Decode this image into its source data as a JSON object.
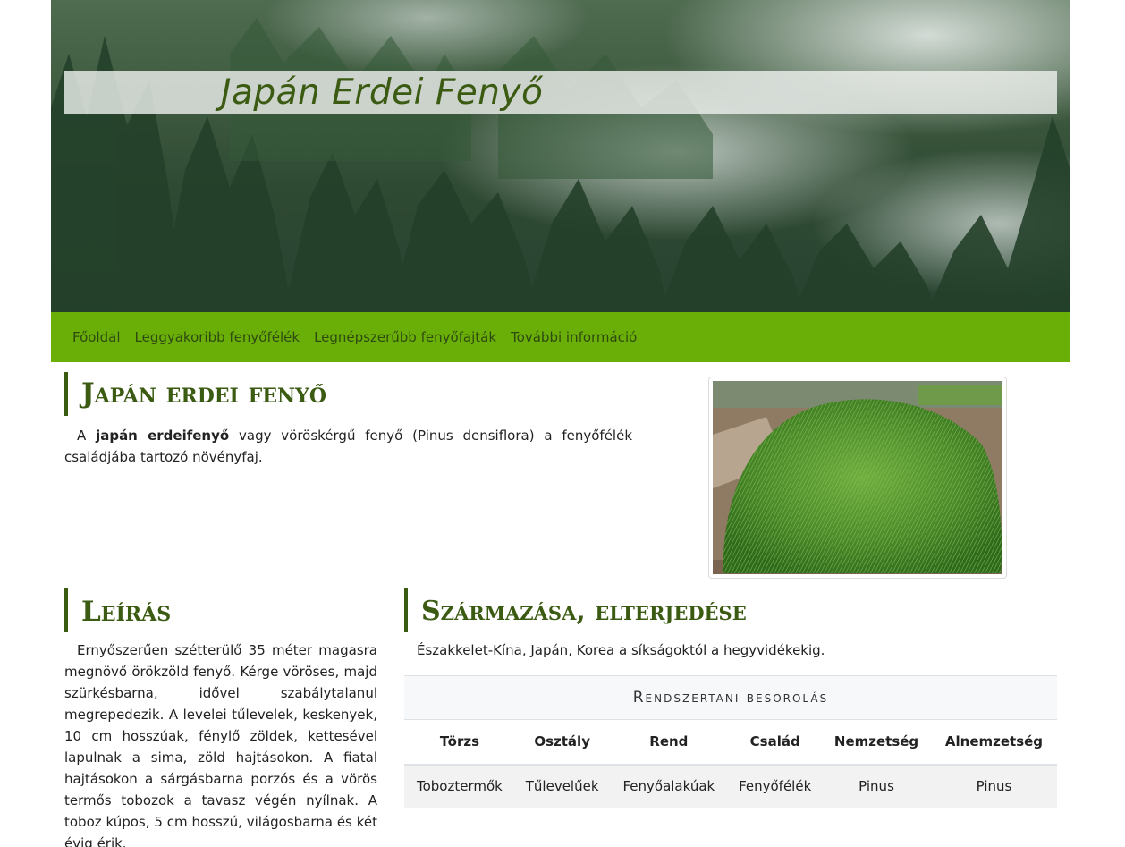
{
  "header": {
    "title": "Japán Erdei Fenyő"
  },
  "nav": {
    "items": [
      {
        "label": "Főoldal"
      },
      {
        "label": "Leggyakoribb fenyőfélék"
      },
      {
        "label": "Legnépszerűbb fenyőfajták"
      },
      {
        "label": "További információ"
      }
    ]
  },
  "main": {
    "heading": "Japán erdei fenyő",
    "intro_prefix": "A ",
    "intro_bold": "japán erdeifenyő",
    "intro_rest": " vagy vöröskérgű fenyő (Pinus densiflora) a fenyőfélék családjába tartozó növényfaj."
  },
  "leiras": {
    "heading": "Leírás",
    "text": "Ernyőszerűen szétterülő 35 méter magasra megnövő örökzöld fenyő. Kérge vöröses, majd szürkésbarna, idővel szabálytalanul megrepedezik. A levelei tűlevelek, keskenyek, 10 cm hosszúak, fénylő zöldek, kettesével lapulnak a sima, zöld hajtásokon. A fiatal hajtásokon a sárgásbarna porzós és a vörös termős tobozok a tavasz végén nyílnak. A toboz kúpos, 5 cm hosszú, világosbarna és két évig érik."
  },
  "szarmazas": {
    "heading": "Származása, elterjedése",
    "text": "Északkelet-Kína, Japán, Korea a síkságoktól a hegyvidékekig."
  },
  "table": {
    "caption": "Rendszertani besorolás",
    "headers": [
      "Törzs",
      "Osztály",
      "Rend",
      "Család",
      "Nemzetség",
      "Alnemzetség"
    ],
    "row": [
      "Toboztermők",
      "Tűlevelűek",
      "Fenyőalakúak",
      "Fenyőfélék",
      "Pinus",
      "Pinus"
    ]
  },
  "colors": {
    "nav_bg": "#6aaf08",
    "heading_green": "#3b5a12"
  }
}
